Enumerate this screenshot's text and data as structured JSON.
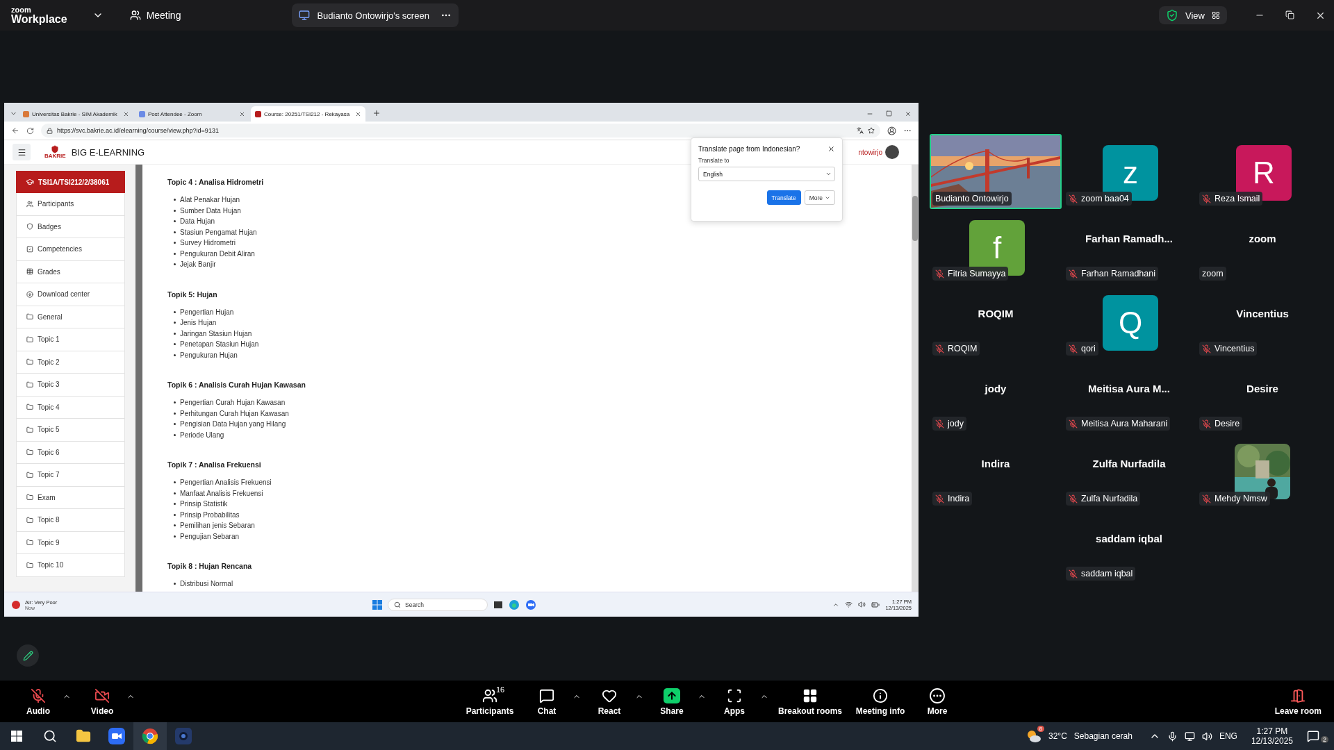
{
  "zoom_bar": {
    "logo_top": "zoom",
    "logo_bottom": "Workplace",
    "meeting_label": "Meeting",
    "share_tab": "Budianto Ontowirjo's screen",
    "view_label": "View"
  },
  "browser": {
    "tabs": [
      {
        "title": "Universitas Bakrie - SIM Akademik",
        "selected": false
      },
      {
        "title": "Post Attendee - Zoom",
        "selected": false
      },
      {
        "title": "Course: 20251/TSI212 - Rekayasa",
        "selected": true
      }
    ],
    "url": "https://svc.bakrie.ac.id/elearning/course/view.php?id=9131"
  },
  "site": {
    "logo_caption": "BAKRIE",
    "title": "BIG E-LEARNING",
    "user": "ntowirjo"
  },
  "course_nav": {
    "course": "TSI1A/TSI212/2/38061",
    "items": [
      {
        "label": "Participants",
        "kind": "users"
      },
      {
        "label": "Badges",
        "kind": "badge"
      },
      {
        "label": "Competencies",
        "kind": "check"
      },
      {
        "label": "Grades",
        "kind": "grid"
      },
      {
        "label": "Download center",
        "kind": "download"
      },
      {
        "label": "General",
        "kind": "folder"
      },
      {
        "label": "Topic 1",
        "kind": "folder"
      },
      {
        "label": "Topic 2",
        "kind": "folder"
      },
      {
        "label": "Topic 3",
        "kind": "folder"
      },
      {
        "label": "Topic 4",
        "kind": "folder"
      },
      {
        "label": "Topic 5",
        "kind": "folder"
      },
      {
        "label": "Topic 6",
        "kind": "folder"
      },
      {
        "label": "Topic 7",
        "kind": "folder"
      },
      {
        "label": "Exam",
        "kind": "folder"
      },
      {
        "label": "Topic 8",
        "kind": "folder"
      },
      {
        "label": "Topic 9",
        "kind": "folder"
      },
      {
        "label": "Topic 10",
        "kind": "folder"
      }
    ]
  },
  "sections": [
    {
      "title": "Topic 4 : Analisa Hidrometri",
      "items": [
        "Alat Penakar Hujan",
        "Sumber Data Hujan",
        "Data Hujan",
        "Stasiun Pengamat Hujan",
        "Survey Hidrometri",
        "Pengukuran Debit Aliran",
        "Jejak Banjir"
      ]
    },
    {
      "title": "Topik 5: Hujan",
      "items": [
        "Pengertian Hujan",
        "Jenis Hujan",
        "Jaringan Stasiun Hujan",
        "Penetapan Stasiun Hujan",
        "Pengukuran Hujan"
      ]
    },
    {
      "title": "Topik 6 : Analisis Curah Hujan Kawasan",
      "items": [
        "Pengertian Curah Hujan Kawasan",
        "Perhitungan Curah Hujan Kawasan",
        "Pengisian Data Hujan yang Hilang",
        "Periode Ulang"
      ]
    },
    {
      "title": "Topik 7 : Analisa Frekuensi",
      "items": [
        "Pengertian Analisis Frekuensi",
        "Manfaat Analisis Frekuensi",
        "Prinsip Statistik",
        "Prinsip Probabilitas",
        "Pemilihan jenis Sebaran",
        "Pengujian Sebaran"
      ]
    },
    {
      "title": "Topik 8 : Hujan Rencana",
      "items": [
        "Distribusi Normal"
      ]
    }
  ],
  "translate_popup": {
    "title": "Translate page from Indonesian?",
    "label": "Translate to",
    "language": "English",
    "primary": "Translate",
    "secondary": "More"
  },
  "inner_taskbar": {
    "air": "Air: Very Poor",
    "air_time": "Now",
    "search": "Search",
    "time": "1:27 PM",
    "date": "12/13/2025"
  },
  "gallery": [
    {
      "name": "Budianto Ontowirjo",
      "kind": "video",
      "muted": false,
      "active": true
    },
    {
      "name": "zoom baa04",
      "kind": "avatar",
      "letter": "z",
      "color": "#00939f",
      "muted": true,
      "active": false
    },
    {
      "name": "Reza Ismail",
      "kind": "avatar",
      "letter": "R",
      "color": "#c8185b",
      "muted": true,
      "active": false
    },
    {
      "name": "Fitria Sumayya",
      "kind": "avatar",
      "letter": "f",
      "color": "#62a23a",
      "muted": true,
      "active": false
    },
    {
      "name": "Farhan Ramadhani",
      "kind": "name",
      "display": "Farhan Ramadh...",
      "muted": true,
      "active": false
    },
    {
      "name": "zoom",
      "kind": "name",
      "display": "zoom",
      "muted": false,
      "active": false
    },
    {
      "name": "ROQIM",
      "kind": "name",
      "display": "ROQIM",
      "muted": true,
      "active": false
    },
    {
      "name": "qori",
      "kind": "avatar",
      "letter": "Q",
      "color": "#00939f",
      "muted": true,
      "active": false
    },
    {
      "name": "Vincentius",
      "kind": "name",
      "display": "Vincentius",
      "muted": true,
      "active": false
    },
    {
      "name": "jody",
      "kind": "name",
      "display": "jody",
      "muted": true,
      "active": false
    },
    {
      "name": "Meitisa Aura Maharani",
      "kind": "name",
      "display": "Meitisa Aura M...",
      "muted": true,
      "active": false
    },
    {
      "name": "Desire",
      "kind": "name",
      "display": "Desire",
      "muted": true,
      "active": false
    },
    {
      "name": "Indira",
      "kind": "name",
      "display": "Indira",
      "muted": true,
      "active": false
    },
    {
      "name": "Zulfa Nurfadila",
      "kind": "name",
      "display": "Zulfa Nurfadila",
      "muted": true,
      "active": false
    },
    {
      "name": "Mehdy Nmsw",
      "muted": true,
      "active": false
    },
    {
      "name": "saddam iqbal",
      "kind": "name",
      "display": "saddam iqbal",
      "muted": true,
      "active": false
    }
  ],
  "audio": {
    "label": "Audio",
    "muted": true
  },
  "video": {
    "label": "Video",
    "off": true
  },
  "controls": [
    {
      "label": "Participants",
      "kind": "participants",
      "count": "16",
      "caret": false
    },
    {
      "label": "Chat",
      "kind": "chat",
      "caret": true
    },
    {
      "label": "React",
      "kind": "react",
      "caret": true
    },
    {
      "label": "Share",
      "kind": "share",
      "caret": true
    },
    {
      "label": "Apps",
      "kind": "apps",
      "caret": true
    },
    {
      "label": "Breakout rooms",
      "kind": "breakout",
      "caret": false
    },
    {
      "label": "Meeting info",
      "kind": "info",
      "caret": false
    },
    {
      "label": "More",
      "kind": "more",
      "caret": false
    }
  ],
  "leave": {
    "label": "Leave room"
  },
  "taskbar": {
    "weather_badge": "8",
    "temperature": "32°C",
    "weather": "Sebagian cerah",
    "language": "ENG",
    "time": "1:27 PM",
    "date": "12/13/2025",
    "notifications": "2"
  }
}
